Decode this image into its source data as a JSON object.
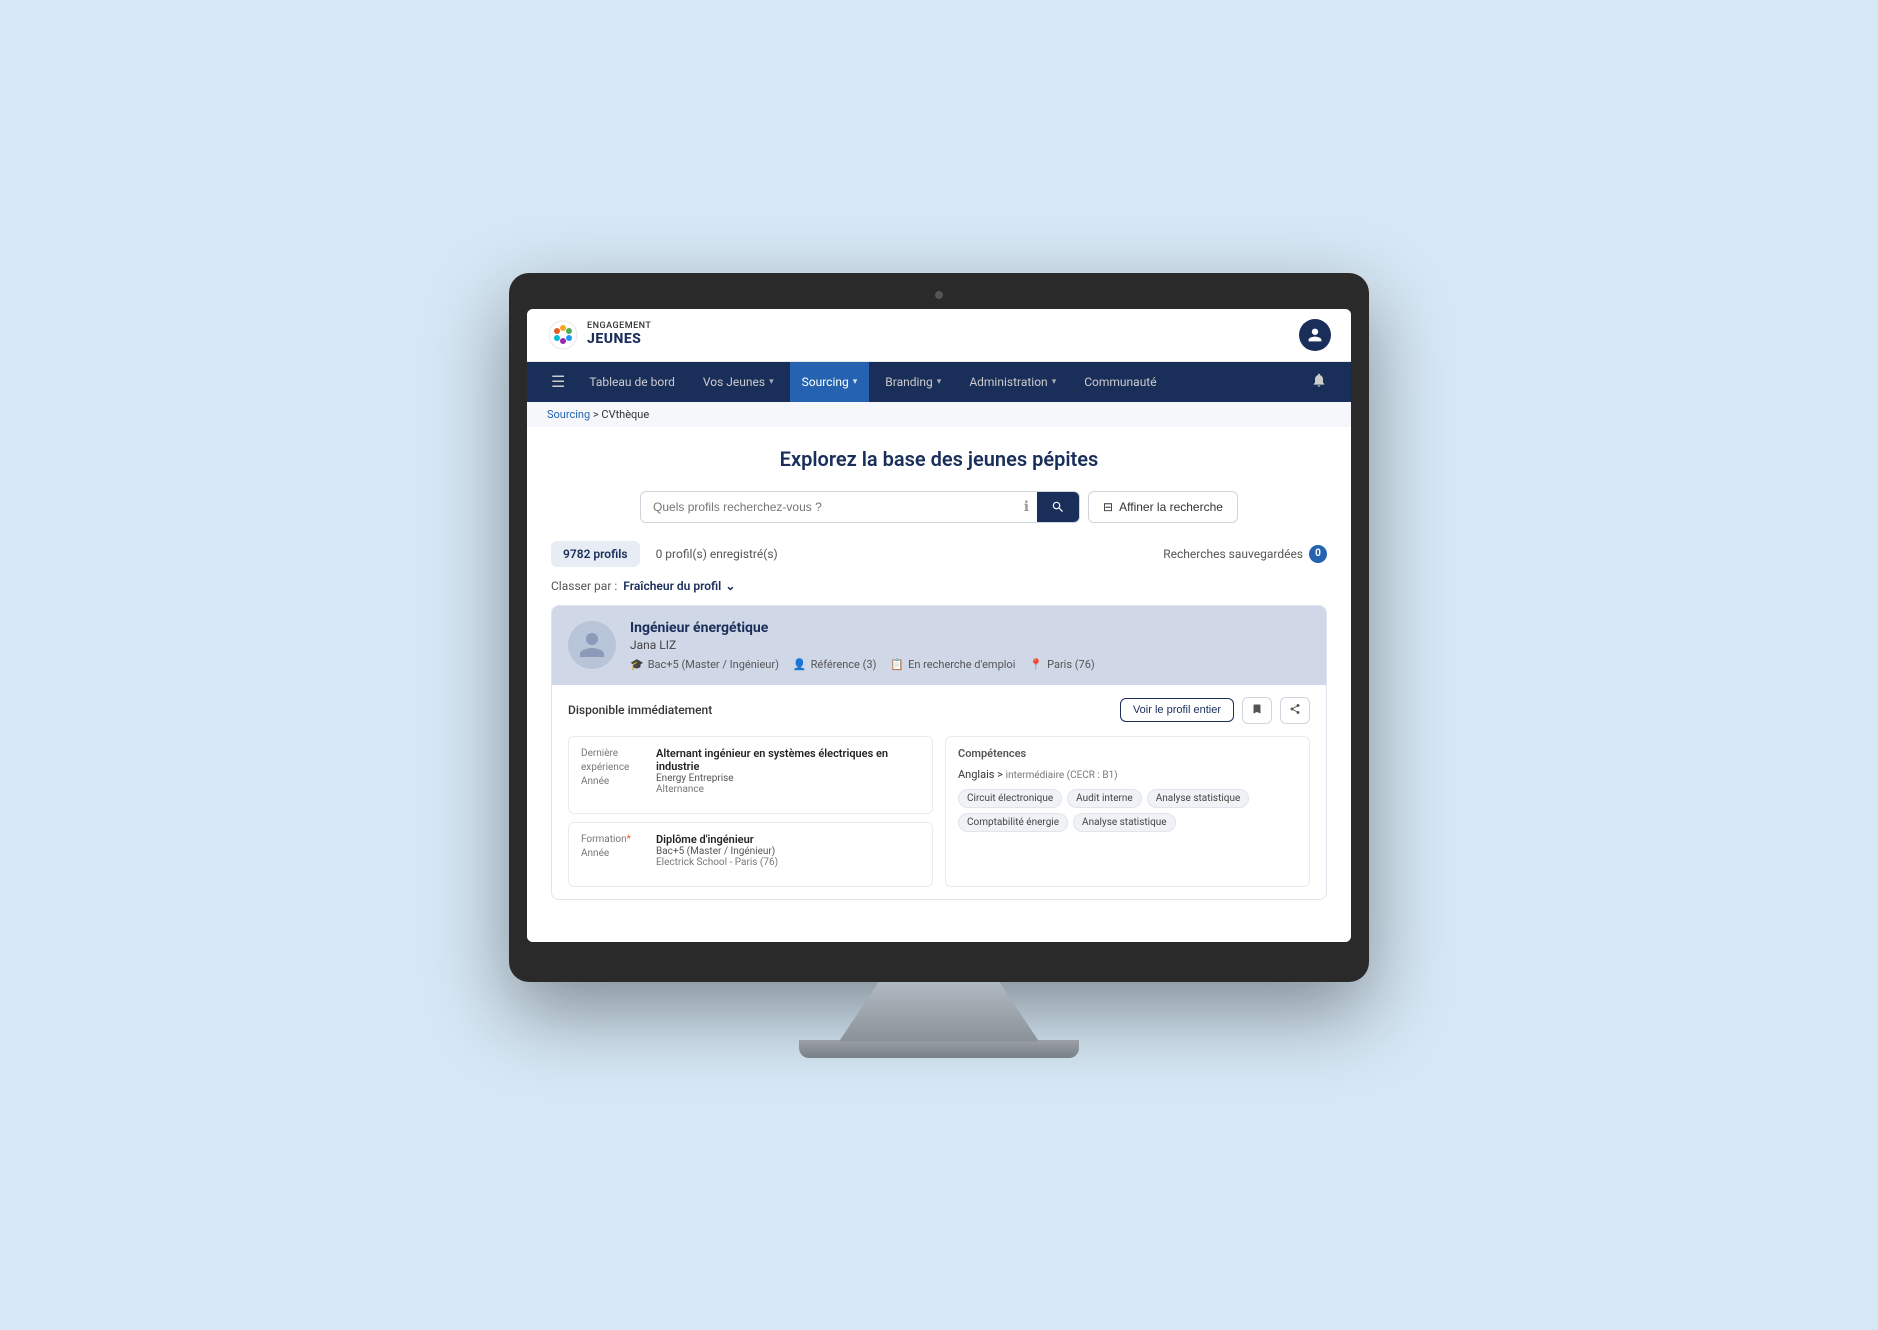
{
  "monitor": {
    "camera": "camera-dot"
  },
  "topbar": {
    "logo_engagement": "ENGAGEMENT",
    "logo_jeunes": "JEUNES",
    "user_icon": "👤"
  },
  "nav": {
    "hamburger": "☰",
    "items": [
      {
        "label": "Tableau de bord",
        "active": false,
        "has_chevron": false
      },
      {
        "label": "Vos Jeunes",
        "active": false,
        "has_chevron": true
      },
      {
        "label": "Sourcing",
        "active": true,
        "has_chevron": true
      },
      {
        "label": "Branding",
        "active": false,
        "has_chevron": true
      },
      {
        "label": "Administration",
        "active": false,
        "has_chevron": true
      },
      {
        "label": "Communauté",
        "active": false,
        "has_chevron": false
      }
    ],
    "bell": "🔔"
  },
  "breadcrumb": {
    "sourcing": "Sourcing",
    "separator": " > ",
    "current": "CVthèque"
  },
  "main": {
    "page_title": "Explorez la base des jeunes pépites",
    "search_placeholder": "Quels profils recherchez-vous ?",
    "filter_button": "Affiner la recherche",
    "search_icon": "🔍",
    "filter_icon": "⊟"
  },
  "stats": {
    "profiles_count": "9782",
    "profiles_label": "profils",
    "saved_count": "0",
    "saved_label": "profil(s) enregistré(s)",
    "saved_searches_label": "Recherches sauvegardées",
    "saved_searches_badge": "0"
  },
  "sort": {
    "label": "Classer par :",
    "value": "Fraîcheur du profil",
    "chevron": "⌄"
  },
  "profile": {
    "job_title": "Ingénieur énergétique",
    "name": "Jana LIZ",
    "education": "Bac+5 (Master / Ingénieur)",
    "references": "Référence (3)",
    "status": "En recherche d'emploi",
    "location": "Paris (76)",
    "availability": "Disponible immédiatement",
    "view_btn": "Voir le profil entier",
    "bookmark_icon": "🔖",
    "share_icon": "⊂",
    "experience": {
      "section_title": "Dernière expérience",
      "year_label": "Année",
      "job_title": "Alternant ingénieur en systèmes électriques en industrie",
      "company": "Energy Entreprise",
      "type": "Alternance"
    },
    "formation": {
      "section_title": "Formation",
      "note": "*",
      "year_label": "Année",
      "degree": "Diplôme d'ingénieur",
      "level": "Bac+5 (Master / Ingénieur)",
      "school": "Electrick School - Paris (76)"
    },
    "competences": {
      "section_title": "Compétences",
      "language": "Anglais",
      "language_sep": " > ",
      "language_level": "intermédiaire (CECR : B1)",
      "skills": [
        "Circuit électronique",
        "Audit interne",
        "Analyse statistique",
        "Comptabilité énergie",
        "Analyse statistique"
      ]
    }
  }
}
